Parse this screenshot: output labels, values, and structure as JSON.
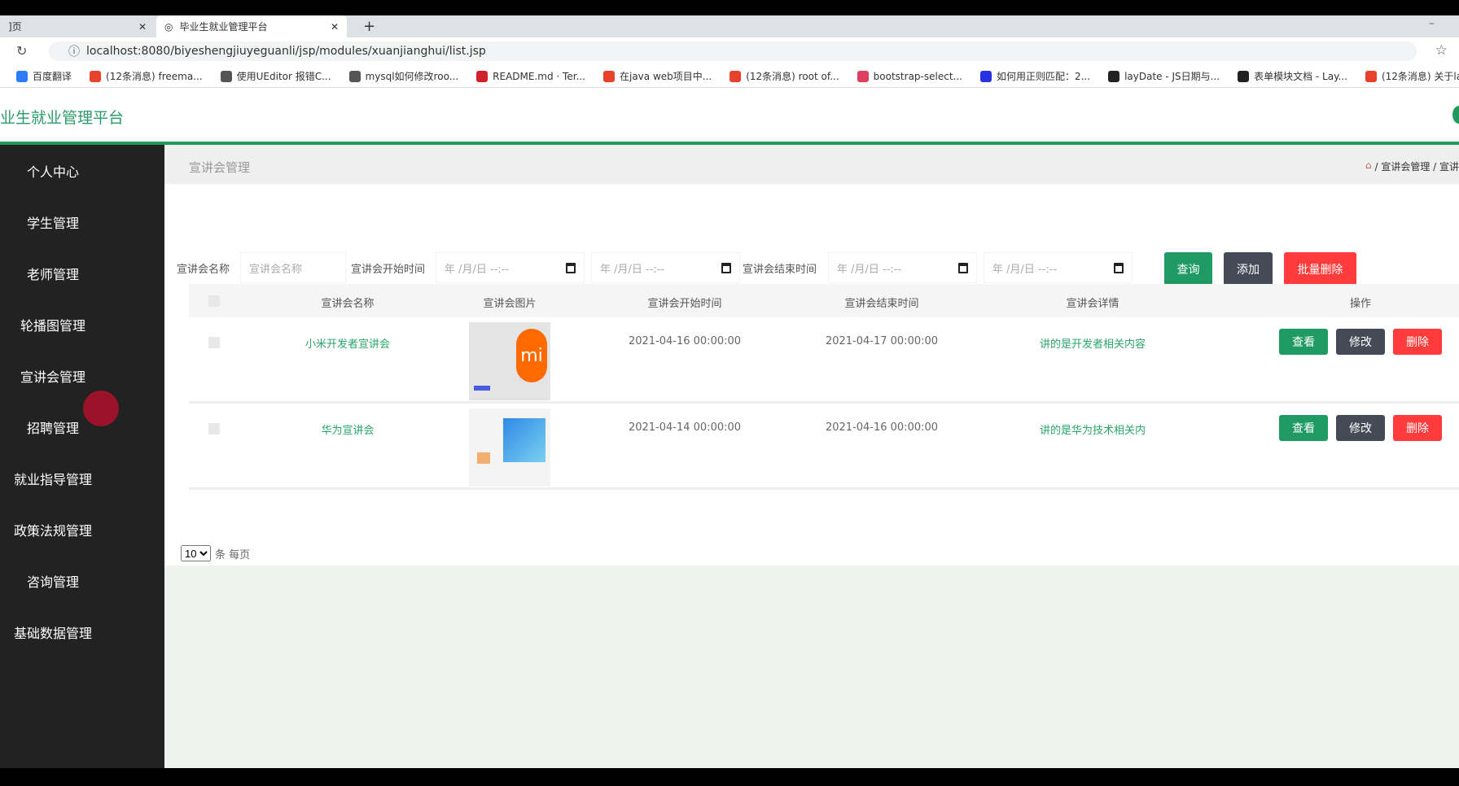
{
  "browser": {
    "tabs": [
      {
        "label": "]页",
        "active": false
      },
      {
        "label": "毕业生就业管理平台",
        "active": true
      }
    ],
    "new_tab": "+",
    "url": "localhost:8080/biyeshengjiuyeguanli/jsp/modules/xuanjianghui/list.jsp",
    "bookmarks": [
      {
        "label": "百度翻译",
        "color": "#2b7cf6"
      },
      {
        "label": "(12条消息) freema...",
        "color": "#e8412c"
      },
      {
        "label": "使用UEditor 报错C...",
        "color": "#555"
      },
      {
        "label": "mysql如何修改roo...",
        "color": "#555"
      },
      {
        "label": "README.md · Ter...",
        "color": "#d0222c"
      },
      {
        "label": "在java web项目中...",
        "color": "#e8412c"
      },
      {
        "label": "(12条消息) root of...",
        "color": "#e8412c"
      },
      {
        "label": "bootstrap-select...",
        "color": "#e04060"
      },
      {
        "label": "如何用正则匹配：2...",
        "color": "#2932e1"
      },
      {
        "label": "layDate - JS日期与...",
        "color": "#222"
      },
      {
        "label": "表单模块文档 - Lay...",
        "color": "#222"
      },
      {
        "label": "(12条消息) 关于lay...",
        "color": "#e8412c"
      }
    ]
  },
  "header": {
    "title": "业生就业管理平台"
  },
  "colors": {
    "accent": "#1d9a5c",
    "query": "#1f9a62",
    "add": "#454a57",
    "delete": "#ff3b3b",
    "sidebar": "#222222"
  },
  "sidebar": {
    "items": [
      {
        "label": "个人中心"
      },
      {
        "label": "学生管理"
      },
      {
        "label": "老师管理"
      },
      {
        "label": "轮播图管理"
      },
      {
        "label": "宣讲会管理"
      },
      {
        "label": "招聘管理"
      },
      {
        "label": "就业指导管理"
      },
      {
        "label": "政策法规管理"
      },
      {
        "label": "咨询管理"
      },
      {
        "label": "基础数据管理"
      }
    ]
  },
  "breadcrumb": {
    "title": "宣讲会管理",
    "home_icon": "home-icon",
    "path": "/ 宣讲会管理 / 宣讲"
  },
  "filter": {
    "name_label": "宣讲会名称",
    "name_placeholder": "宣讲会名称",
    "start_label": "宣讲会开始时间",
    "end_label": "宣讲会结束时间",
    "date_placeholder": "年 /月/日 --:--",
    "query": "查询",
    "add": "添加",
    "batch_delete": "批量删除"
  },
  "table": {
    "headers": [
      "宣讲会名称",
      "宣讲会图片",
      "宣讲会开始时间",
      "宣讲会结束时间",
      "宣讲会详情",
      "操作"
    ],
    "rows": [
      {
        "name": "小米开发者宣讲会",
        "start": "2021-04-16 00:00:00",
        "end": "2021-04-17 00:00:00",
        "detail": "讲的是开发者相关内容"
      },
      {
        "name": "华为宣讲会",
        "start": "2021-04-14 00:00:00",
        "end": "2021-04-16 00:00:00",
        "detail": "讲的是华为技术相关内"
      }
    ],
    "actions": {
      "view": "查看",
      "edit": "修改",
      "delete": "删除"
    }
  },
  "pager": {
    "page_size": "10",
    "suffix": "条 每页"
  }
}
